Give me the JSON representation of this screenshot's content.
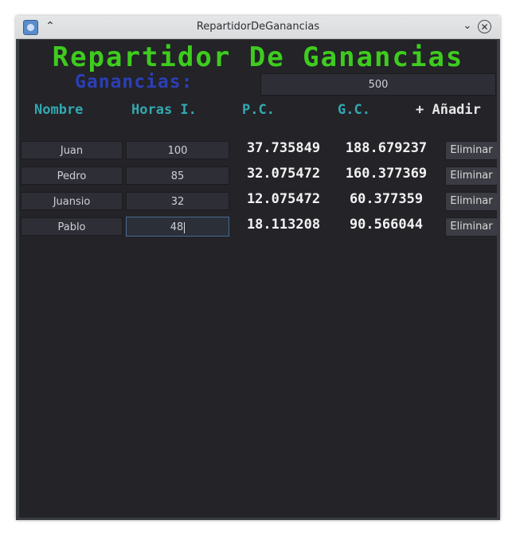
{
  "window": {
    "title": "RepartidorDeGanancias"
  },
  "app": {
    "heading": "Repartidor De Ganancias",
    "ganancias_label": "Ganancias:",
    "ganancias_value": "500"
  },
  "columns": {
    "nombre": "Nombre",
    "horas": "Horas I.",
    "pc": "P.C.",
    "gc": "G.C.",
    "add": "+ Añadir"
  },
  "rows": [
    {
      "name": "Juan",
      "hours": "100",
      "pc": "37.735849",
      "gc": "188.679237",
      "delete": "Eliminar"
    },
    {
      "name": "Pedro",
      "hours": "85",
      "pc": "32.075472",
      "gc": "160.377369",
      "delete": "Eliminar"
    },
    {
      "name": "Juansio",
      "hours": "32",
      "pc": "12.075472",
      "gc": "60.377359",
      "delete": "Eliminar"
    },
    {
      "name": "Pablo",
      "hours": "48",
      "pc": "18.113208",
      "gc": "90.566044",
      "delete": "Eliminar"
    }
  ],
  "icons": {
    "app": "godot-app-icon",
    "keep_above": "double-chevron-up-icon",
    "minimize": "chevron-down-icon",
    "close": "close-icon"
  },
  "colors": {
    "heading": "#3ecc1e",
    "ganancias_label": "#2c3fb8",
    "column_header": "#33a8b0",
    "background": "#232328"
  }
}
